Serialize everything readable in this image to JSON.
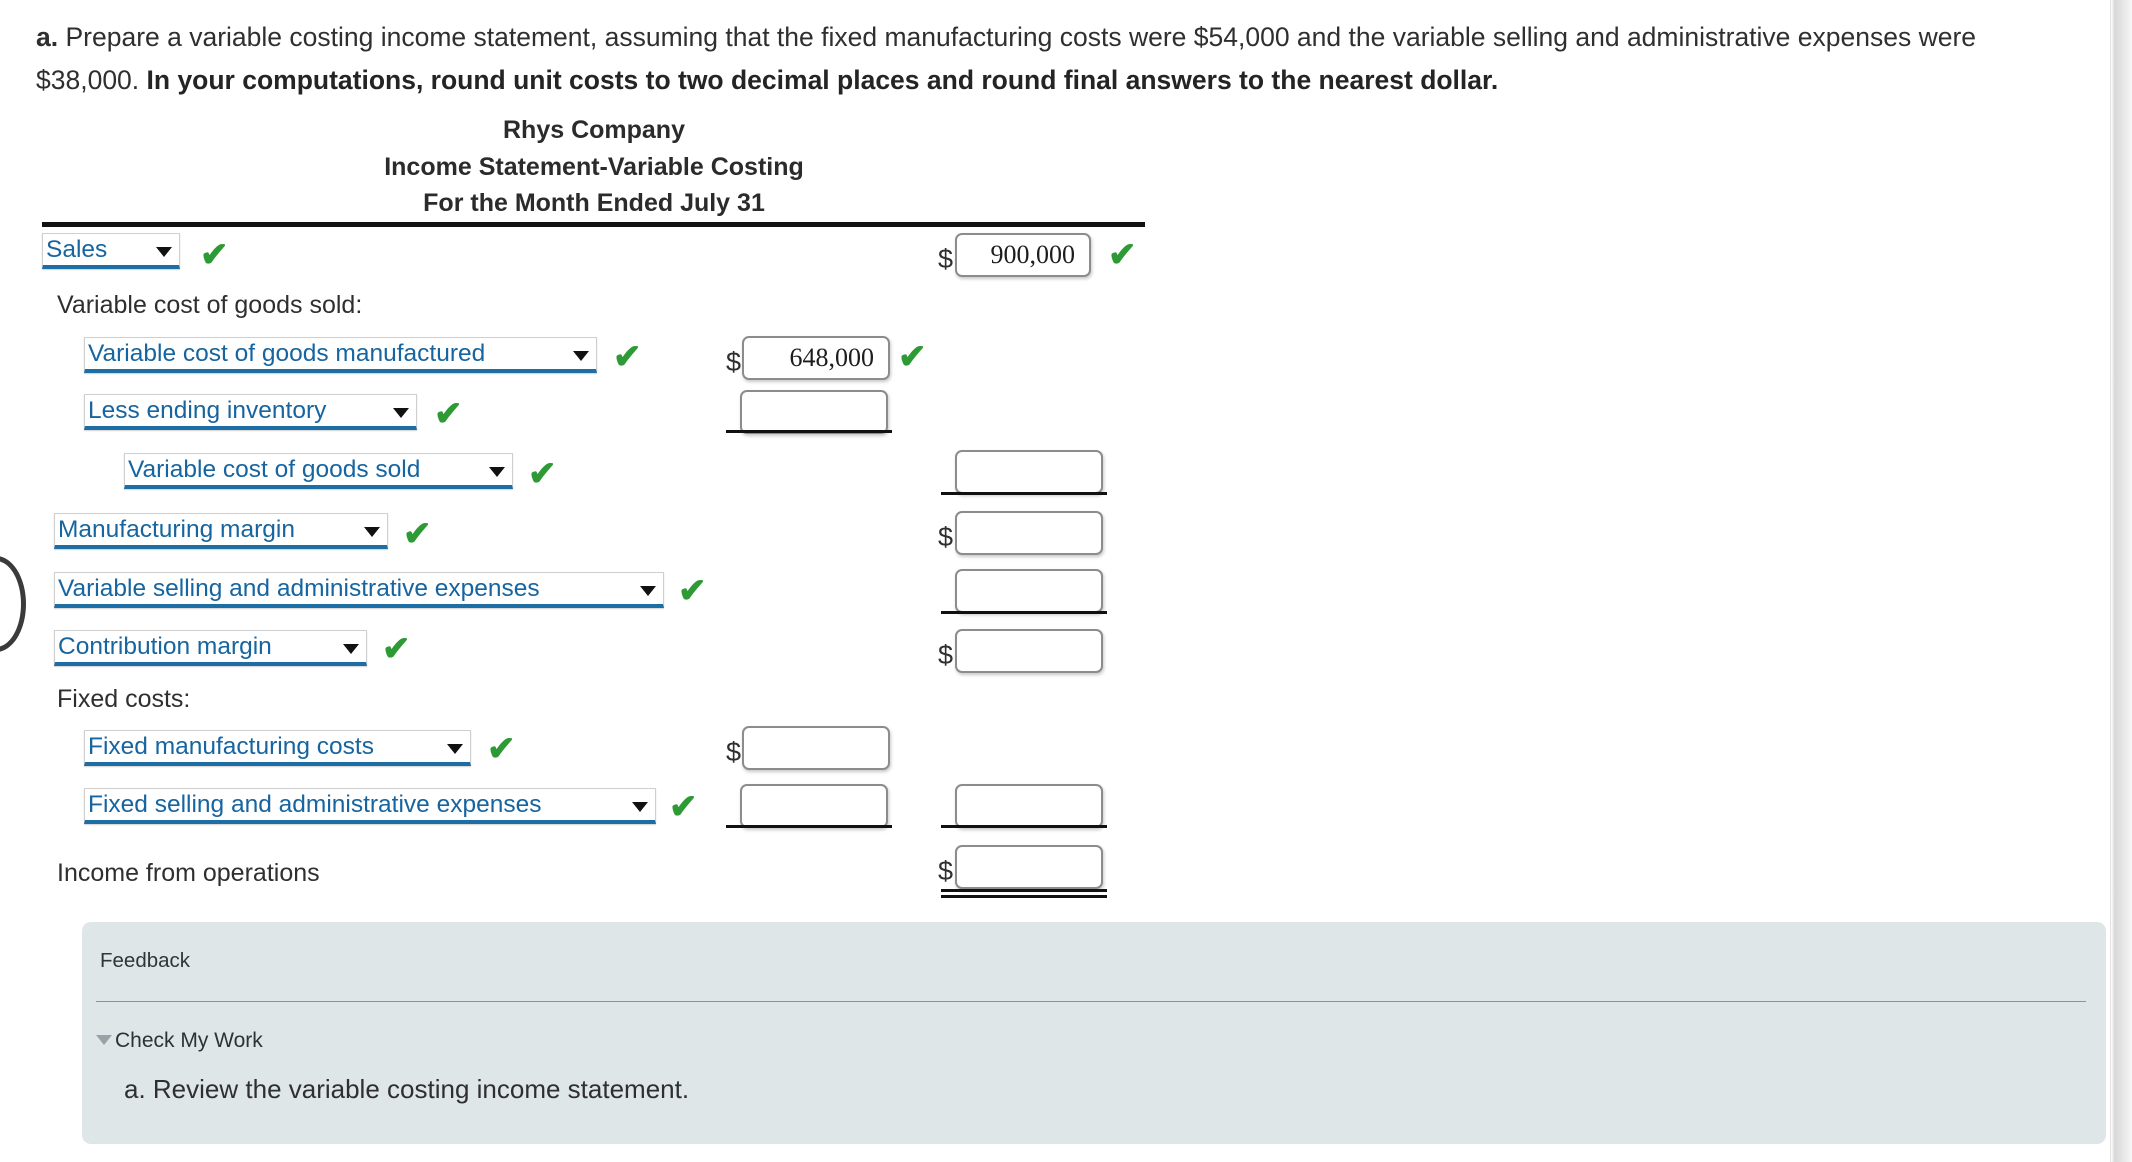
{
  "prompt": {
    "label": "a.",
    "text_normal_1": "Prepare a variable costing income statement, assuming that the fixed manufacturing costs were $54,000 and the variable selling and administrative expenses were $38,000.",
    "text_bold": "In your computations, round unit costs to two decimal places and round final answers to the nearest dollar."
  },
  "statement": {
    "company": "Rhys Company",
    "title": "Income Statement-Variable Costing",
    "period": "For the Month Ended July 31",
    "rows": [
      {
        "id": "sales",
        "kind": "select",
        "label": "Sales",
        "checked": true,
        "amount": {
          "value": "900,000",
          "dollar": true,
          "checked": true,
          "column": "right"
        }
      },
      {
        "id": "vcogs-header",
        "kind": "text",
        "label": "Variable cost of goods sold:"
      },
      {
        "id": "v-cogm",
        "kind": "select",
        "label": "Variable cost of goods manufactured",
        "checked": true,
        "amount": {
          "value": "648,000",
          "dollar": true,
          "checked": true,
          "column": "middle"
        }
      },
      {
        "id": "less-ending-inventory",
        "kind": "select",
        "label": "Less ending inventory",
        "checked": true,
        "amount": {
          "value": "",
          "dollar": false,
          "checked": false,
          "column": "middle"
        }
      },
      {
        "id": "v-cogs",
        "kind": "select",
        "label": "Variable cost of goods sold",
        "checked": true,
        "amount": {
          "value": "",
          "dollar": false,
          "checked": false,
          "column": "right"
        }
      },
      {
        "id": "manufacturing-margin",
        "kind": "select",
        "label": "Manufacturing margin",
        "checked": true,
        "amount": {
          "value": "",
          "dollar": true,
          "checked": false,
          "column": "right"
        }
      },
      {
        "id": "v-sga",
        "kind": "select",
        "label": "Variable selling and administrative expenses",
        "checked": true,
        "amount": {
          "value": "",
          "dollar": false,
          "checked": false,
          "column": "right"
        }
      },
      {
        "id": "contribution-margin",
        "kind": "select",
        "label": "Contribution margin",
        "checked": true,
        "amount": {
          "value": "",
          "dollar": true,
          "checked": false,
          "column": "right"
        }
      },
      {
        "id": "fixed-costs-header",
        "kind": "text",
        "label": "Fixed costs:"
      },
      {
        "id": "fixed-mfg",
        "kind": "select",
        "label": "Fixed manufacturing costs",
        "checked": true,
        "amount": {
          "value": "",
          "dollar": true,
          "checked": false,
          "column": "middle"
        }
      },
      {
        "id": "fixed-sga",
        "kind": "select",
        "label": "Fixed selling and administrative expenses",
        "checked": true,
        "amount": {
          "value": "",
          "dollar": false,
          "checked": false,
          "column": "middle"
        },
        "amount2": {
          "value": "",
          "dollar": false,
          "checked": false,
          "column": "right"
        }
      },
      {
        "id": "income-from-operations",
        "kind": "text",
        "label": "Income from operations",
        "amount": {
          "value": "",
          "dollar": true,
          "checked": false,
          "column": "right"
        }
      }
    ],
    "check_glyph": "✔",
    "dollar_sign": "$"
  },
  "feedback": {
    "title": "Feedback",
    "toggle": "Check My Work",
    "body": "a. Review the variable costing income statement."
  },
  "colors": {
    "select_text": "#1665a0",
    "select_underline": "#1c6ea4",
    "check_green": "#2e9a36",
    "feedback_bg": "#dfe6e8"
  }
}
